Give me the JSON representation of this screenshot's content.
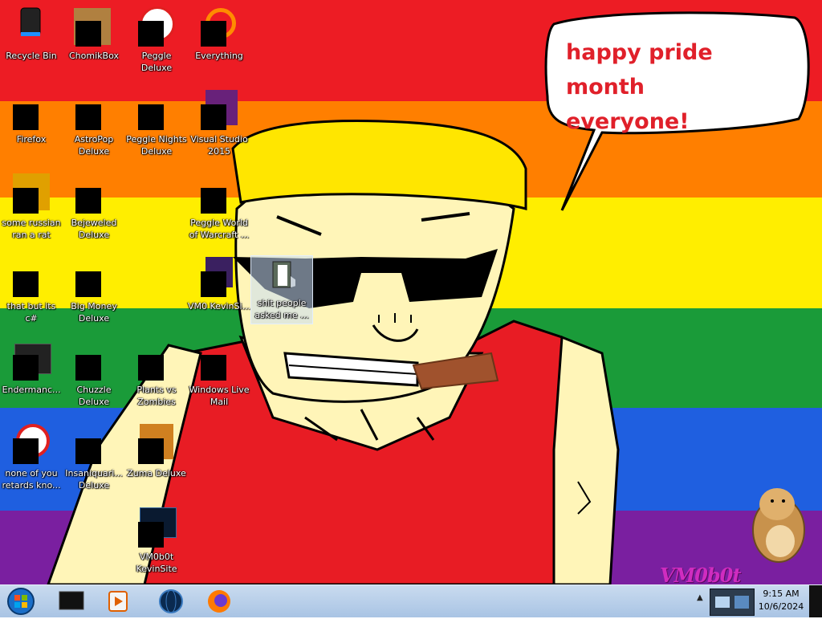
{
  "wallpaper": {
    "stripes": [
      "#ed1c24",
      "#ff7f00",
      "#ffee00",
      "#1a9b39",
      "#1f5fe0",
      "#7a1fa0"
    ],
    "speech_bubble": "happy pride month everyone!",
    "speech_lines": [
      "happy pride month",
      "everyone!"
    ],
    "watermark": "VM0b0t"
  },
  "desktop_icons": [
    {
      "label": "Recycle Bin",
      "icon": "recycle-bin-icon",
      "masked": false
    },
    {
      "label": "ChomikBox",
      "icon": "chomikbox-icon",
      "masked": true
    },
    {
      "label": "Peggle Deluxe",
      "icon": "peggle-icon",
      "masked": true
    },
    {
      "label": "Everything",
      "icon": "everything-search-icon",
      "masked": true
    },
    {
      "label": "Firefox",
      "icon": "firefox-icon",
      "masked": true
    },
    {
      "label": "AstroPop Deluxe",
      "icon": "astropop-icon",
      "masked": true
    },
    {
      "label": "Peggle Nights Deluxe",
      "icon": "peggle-nights-icon",
      "masked": true
    },
    {
      "label": "Visual Studio 2015",
      "icon": "visual-studio-icon",
      "masked": true
    },
    {
      "label": "some russian ran a rat",
      "icon": "document-icon",
      "masked": true
    },
    {
      "label": "Bejeweled Deluxe",
      "icon": "bejeweled-icon",
      "masked": true
    },
    {
      "label": "Peggle World of Warcraft ...",
      "icon": "peggle-wow-icon",
      "masked": true
    },
    {
      "label": "that but its c#",
      "icon": "folder-icon",
      "masked": true
    },
    {
      "label": "Big Money Deluxe",
      "icon": "big-money-icon",
      "masked": true
    },
    {
      "label": "VM0 KevinSi...",
      "icon": "vm-icon",
      "masked": true
    },
    {
      "label": "shit people asked me ...",
      "icon": "text-file-icon",
      "masked": false
    },
    {
      "label": "Endermanc...",
      "icon": "console-icon",
      "masked": true
    },
    {
      "label": "Chuzzle Deluxe",
      "icon": "chuzzle-icon",
      "masked": true
    },
    {
      "label": "Plants vs Zombies",
      "icon": "pvz-icon",
      "masked": true
    },
    {
      "label": "Windows Live Mail",
      "icon": "mail-icon",
      "masked": true
    },
    {
      "label": "none of you retards kno...",
      "icon": "shortcut-icon",
      "masked": true
    },
    {
      "label": "Insaniquari... Deluxe",
      "icon": "insaniquarium-icon",
      "masked": true
    },
    {
      "label": "Zuma Deluxe",
      "icon": "zuma-icon",
      "masked": true
    },
    {
      "label": "VM0b0t KevinSite",
      "icon": "monitor-icon",
      "masked": true
    }
  ],
  "taskbar": {
    "start": "start-orb-icon",
    "pinned": [
      "cmd-icon",
      "media-player-icon",
      "globe-icon",
      "firefox-icon"
    ],
    "clock_time": "9:15 AM",
    "clock_date": "10/6/2024"
  }
}
